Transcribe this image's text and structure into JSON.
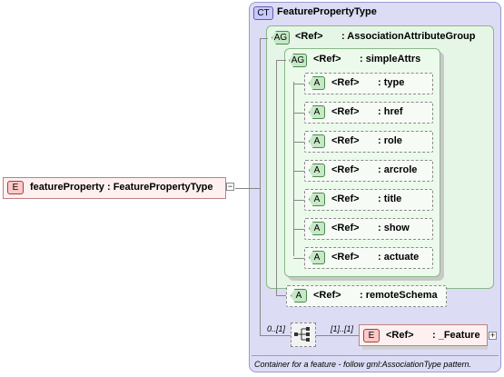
{
  "root_element": {
    "badge": "E",
    "label": "featureProperty : FeaturePropertyType",
    "toggle": "−"
  },
  "complex_type": {
    "badge": "CT",
    "title": "FeaturePropertyType"
  },
  "association_group": {
    "badge": "AG",
    "ref": "<Ref>",
    "name": ": AssociationAttributeGroup"
  },
  "simple_attrs": {
    "badge": "AG",
    "ref": "<Ref>",
    "name": ": simpleAttrs"
  },
  "attributes": [
    {
      "badge": "A",
      "ref": "<Ref>",
      "name": ": type"
    },
    {
      "badge": "A",
      "ref": "<Ref>",
      "name": ": href"
    },
    {
      "badge": "A",
      "ref": "<Ref>",
      "name": ": role"
    },
    {
      "badge": "A",
      "ref": "<Ref>",
      "name": ": arcrole"
    },
    {
      "badge": "A",
      "ref": "<Ref>",
      "name": ": title"
    },
    {
      "badge": "A",
      "ref": "<Ref>",
      "name": ": show"
    },
    {
      "badge": "A",
      "ref": "<Ref>",
      "name": ": actuate"
    }
  ],
  "remote_schema": {
    "badge": "A",
    "ref": "<Ref>",
    "name": ": remoteSchema"
  },
  "sequence": {
    "min_occurs": "0..[1]",
    "child_occurs": "[1]..[1]"
  },
  "feature_element": {
    "badge": "E",
    "ref": "<Ref>",
    "name": ": _Feature",
    "toggle": "+"
  },
  "documentation": "Container for a feature - follow gml:AssociationType pattern."
}
